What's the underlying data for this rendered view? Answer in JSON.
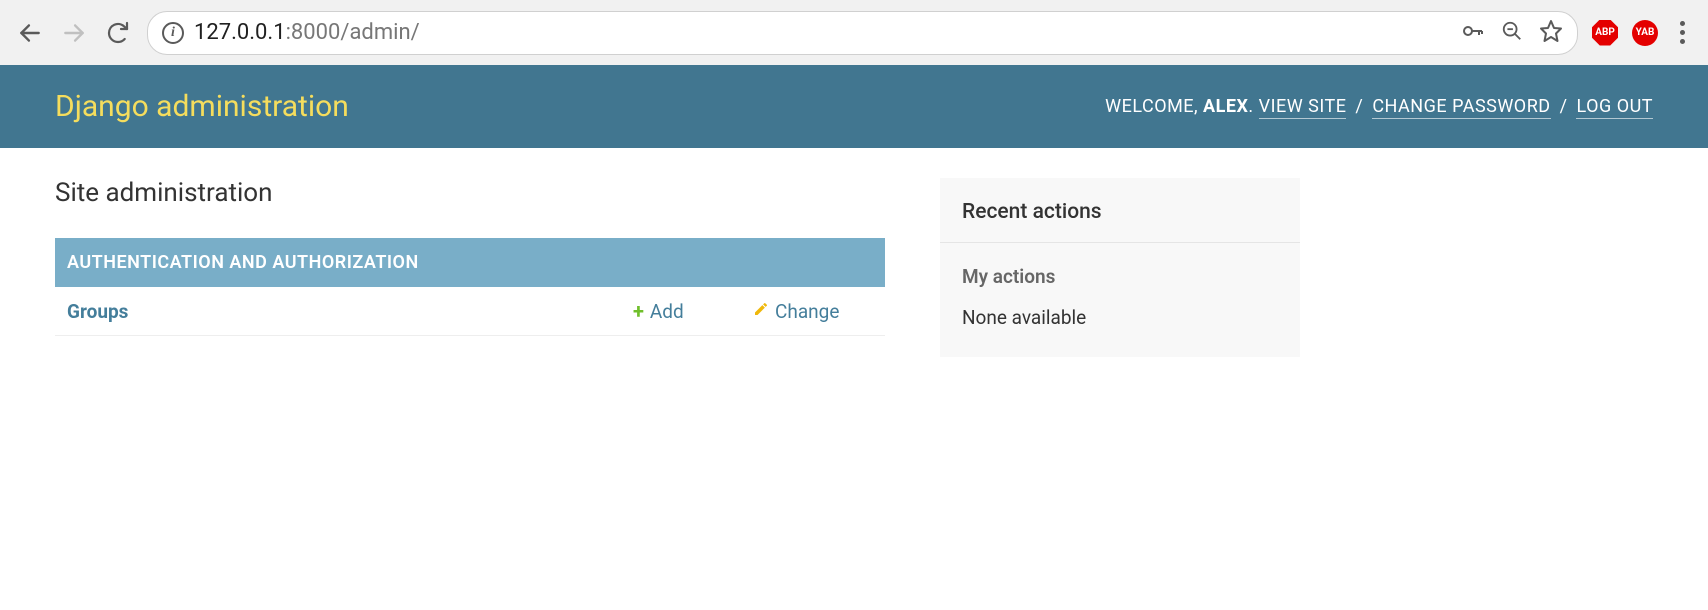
{
  "browser": {
    "url_host": "127.0.0.1",
    "url_port": ":8000",
    "url_path": "/admin/",
    "ext1": "ABP",
    "ext2": "YAB"
  },
  "header": {
    "title": "Django administration",
    "welcome_prefix": "WELCOME, ",
    "username": "ALEX",
    "welcome_suffix": ". ",
    "view_site": "VIEW SITE",
    "change_password": "CHANGE PASSWORD",
    "logout": "LOG OUT",
    "separator": " / "
  },
  "content": {
    "page_title": "Site administration",
    "module_caption": "AUTHENTICATION AND AUTHORIZATION",
    "models": [
      {
        "name": "Groups",
        "add_label": "Add",
        "change_label": "Change"
      }
    ]
  },
  "sidebar": {
    "recent_actions_title": "Recent actions",
    "my_actions_title": "My actions",
    "none_text": "None available"
  }
}
